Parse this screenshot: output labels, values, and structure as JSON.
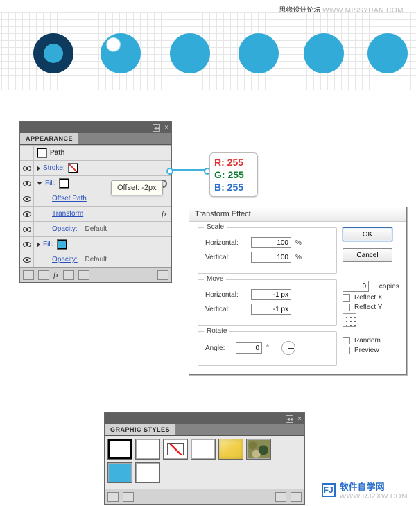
{
  "header": {
    "cn": "思缘设计论坛",
    "site": "WWW.MISSYUAN.COM"
  },
  "app": {
    "title": "APPEARANCE",
    "path_label": "Path",
    "stroke_label": "Stroke:",
    "fill_label": "Fill:",
    "offset_path": "Offset Path",
    "transform": "Transform",
    "opacity": "Opacity:",
    "default": "Default"
  },
  "offset_tip": {
    "label": "Offset:",
    "value": "-2px"
  },
  "rgb": {
    "r": "R: 255",
    "g": "G: 255",
    "b": "B: 255"
  },
  "dlg": {
    "title": "Transform Effect",
    "scale": "Scale",
    "horizontal": "Horizontal:",
    "vertical": "Vertical:",
    "hv": "100",
    "vv": "100",
    "pct": "%",
    "move": "Move",
    "mh": "-1 px",
    "mv": "-1 px",
    "rotate": "Rotate",
    "angle": "Angle:",
    "angle_v": "0",
    "deg": "°",
    "ok": "OK",
    "cancel": "Cancel",
    "copies": "copies",
    "copies_v": "0",
    "reflectx": "Reflect X",
    "reflecty": "Reflect Y",
    "random": "Random",
    "preview": "Preview"
  },
  "gs": {
    "title": "GRAPHIC STYLES"
  },
  "brand": {
    "cn": "软件自学网",
    "en": "WWW.RJZXW.COM"
  }
}
